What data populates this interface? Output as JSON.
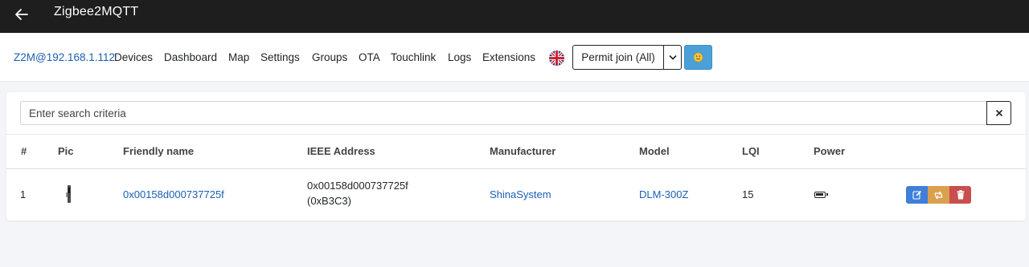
{
  "app": {
    "title": "Zigbee2MQTT"
  },
  "nav": {
    "brand": "Z2M@192.168.1.112",
    "items": [
      {
        "label": "Devices"
      },
      {
        "label": "Dashboard"
      },
      {
        "label": "Map"
      },
      {
        "label": "Settings"
      },
      {
        "label": "Groups"
      },
      {
        "label": "OTA"
      },
      {
        "label": "Touchlink"
      },
      {
        "label": "Logs"
      },
      {
        "label": "Extensions"
      }
    ],
    "language_icon": "uk-flag-icon",
    "permit_join_label": "Permit join (All)",
    "emoji_icon": "smiley-icon"
  },
  "search": {
    "placeholder": "Enter search criteria",
    "value": ""
  },
  "table": {
    "headers": [
      "#",
      "Pic",
      "Friendly name",
      "IEEE Address",
      "Manufacturer",
      "Model",
      "LQI",
      "Power"
    ],
    "rows": [
      {
        "index": "1",
        "friendly_name": "0x00158d000737725f",
        "ieee_address": "0x00158d000737725f",
        "network_address": "(0xB3C3)",
        "manufacturer": "ShinaSystem",
        "model": "DLM-300Z",
        "lqi": "15",
        "power_icon": "battery-icon"
      }
    ]
  },
  "colors": {
    "link": "#1a5fb4",
    "edit": "#3d7fd9",
    "swap": "#d9a04e",
    "delete": "#c94e4e",
    "topbar": "#1e1e1e"
  }
}
